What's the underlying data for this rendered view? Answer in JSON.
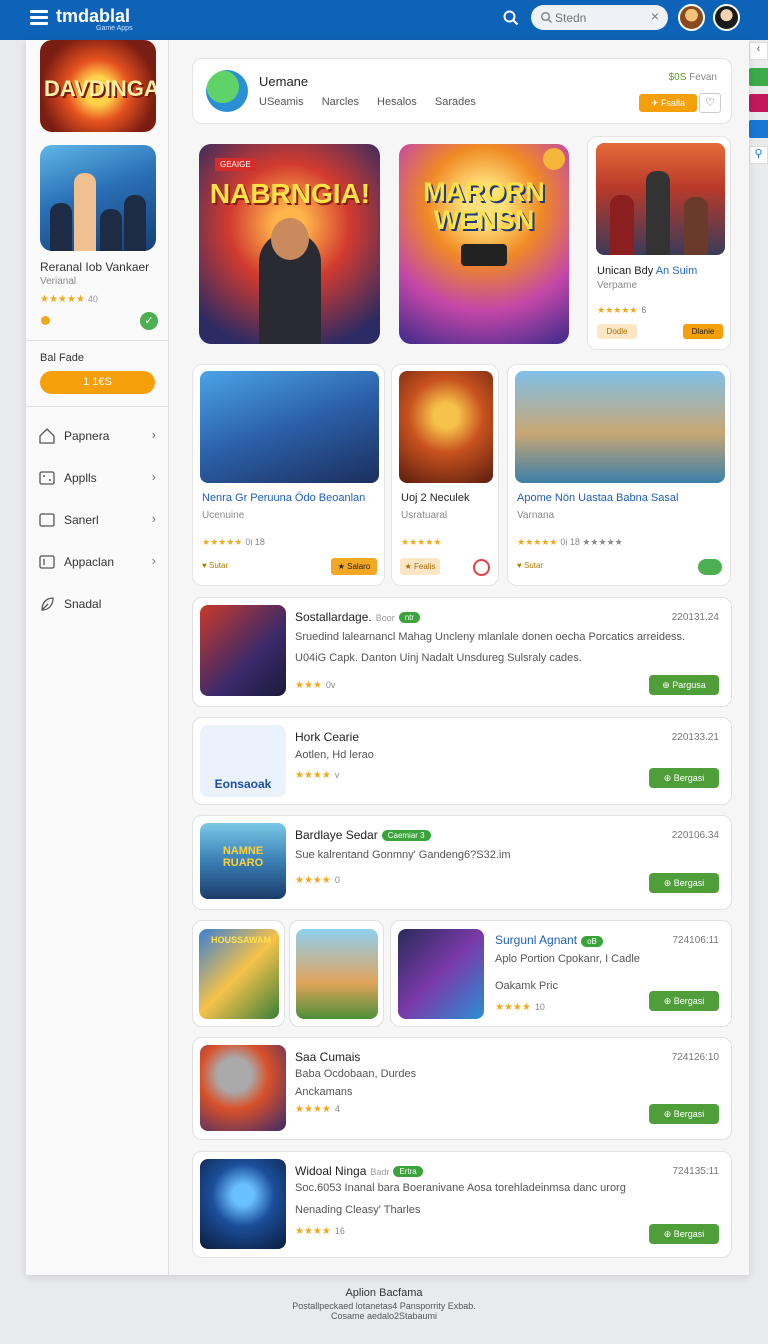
{
  "header": {
    "brand": "tmdablal",
    "brand_sub": "Game Apps",
    "search_placeholder": "Stedn",
    "clear_glyph": "×"
  },
  "sidebar": {
    "top_game": {
      "logo_text": "DAVDINGAT"
    },
    "game": {
      "title": "Reranal Iob Vankaer",
      "subtitle": "Verianal",
      "stars": "★★★★★",
      "count": "40"
    },
    "balance_label": "Bal Fade",
    "balance_value": "1 1€S",
    "nav": [
      {
        "label": "Papnera",
        "icon": "home-icon"
      },
      {
        "label": "Applls",
        "icon": "apps-icon"
      },
      {
        "label": "Sanerl",
        "icon": "square-icon"
      },
      {
        "label": "Appaclan",
        "icon": "app-icon"
      },
      {
        "label": "Snadal",
        "icon": "leaf-icon"
      }
    ],
    "chevron": "›"
  },
  "profile": {
    "name": "Uemane",
    "tabs": [
      "USeamis",
      "Narcles",
      "Hesalos",
      "Sarades"
    ],
    "price": "$0S",
    "price_label": "Fevan",
    "button": "Fsalla",
    "heart": "♡"
  },
  "featured": [
    {
      "title": "NABRNGIA!",
      "tag": "GEAIGE"
    },
    {
      "title": "MARORN WENSN"
    },
    {
      "title": "Unican Bdy An Suim",
      "title_plain": "Unican Bdy",
      "title_highlight": " An Suim",
      "subtitle": "Verpame",
      "stars": "★★★★★",
      "count": "6",
      "btn1": "Dodle",
      "btn2": "Dlanie"
    }
  ],
  "cards": [
    {
      "title": "Nenra Gr Peruuna Ödo Beoanlan",
      "subtitle": "Ucenuine",
      "stars": "★★★★★",
      "count": "0i    18",
      "status": "Sutar",
      "button": "Salaro"
    },
    {
      "title": "Uoj 2 Neculek",
      "subtitle": "Usratuaral",
      "stars": "★★★★★",
      "count": "",
      "button": "Fealis"
    },
    {
      "title": "Apome Nön Uastaa Babna Sasal",
      "subtitle": "Varnana",
      "stars": "★★★★★",
      "count": "0i  18  ★★★★★",
      "status": "Sutar"
    }
  ],
  "list": [
    {
      "name": "Sostallardage.",
      "meta": "Boor",
      "pill": "ntr",
      "desc1": "Sruedind lalearnancl Mahag Uncleny mlanlale donen oecha Porcatics arreidess.",
      "desc2": "U04iG Capk. Danton Uinj Nadalt   Unsdureg Sulsraly cades.",
      "stars": "★★★",
      "count": "0v",
      "date": "220131.24",
      "button": "Pargusa"
    },
    {
      "name": "Hork Cearie",
      "desc1": "Aotlen, Hd lerao",
      "stars": "★★★★",
      "count": "v",
      "date": "220133.21",
      "button": "Bergasi",
      "thumb_text": "Eonsaoak"
    },
    {
      "name": "Bardlaye Sedar",
      "pill": "Caemiar 3",
      "desc1": "Sue kalrentand Gonmny' Gandeng6?S32.im",
      "stars": "★★★★",
      "count": "0",
      "date": "220106.34",
      "button": "Bergasi",
      "thumb_text": "NAMNE RUARO"
    },
    {
      "name": "Surgunl Agnant",
      "pill": "oB",
      "desc1": "Aplo Portion Cpokanr, I Cadle",
      "desc2": "Oakamk Pric",
      "stars": "★★★★",
      "count": "10",
      "date": "724106:11",
      "button": "Bergasi",
      "thumb_text": "HOUSSAWAM"
    },
    {
      "name": "Saa Cumais",
      "desc1": "Baba Ocdobaan, Durdes",
      "desc2": "Anckamans",
      "stars": "★★★★",
      "count": "4",
      "date": "724126:10",
      "button": "Bergasi"
    },
    {
      "name": "Widoal Ninga",
      "meta": "Badr",
      "pill": "Ertra",
      "desc1": "Soc.6053 Inanal bara Boeranivane Aosa torehladeinmsa danc urorg",
      "desc2": "Nenading Cleasy' Tharles",
      "stars": "★★★★",
      "count": "16",
      "date": "724135:11",
      "button": "Bergasi"
    }
  ],
  "footer": {
    "title": "Aplion Bacfama",
    "line1": "Postallpeckaed lotanetas4 Pansporrity Exbab.",
    "line2": "Cosame aedalo2Stabaumi"
  }
}
